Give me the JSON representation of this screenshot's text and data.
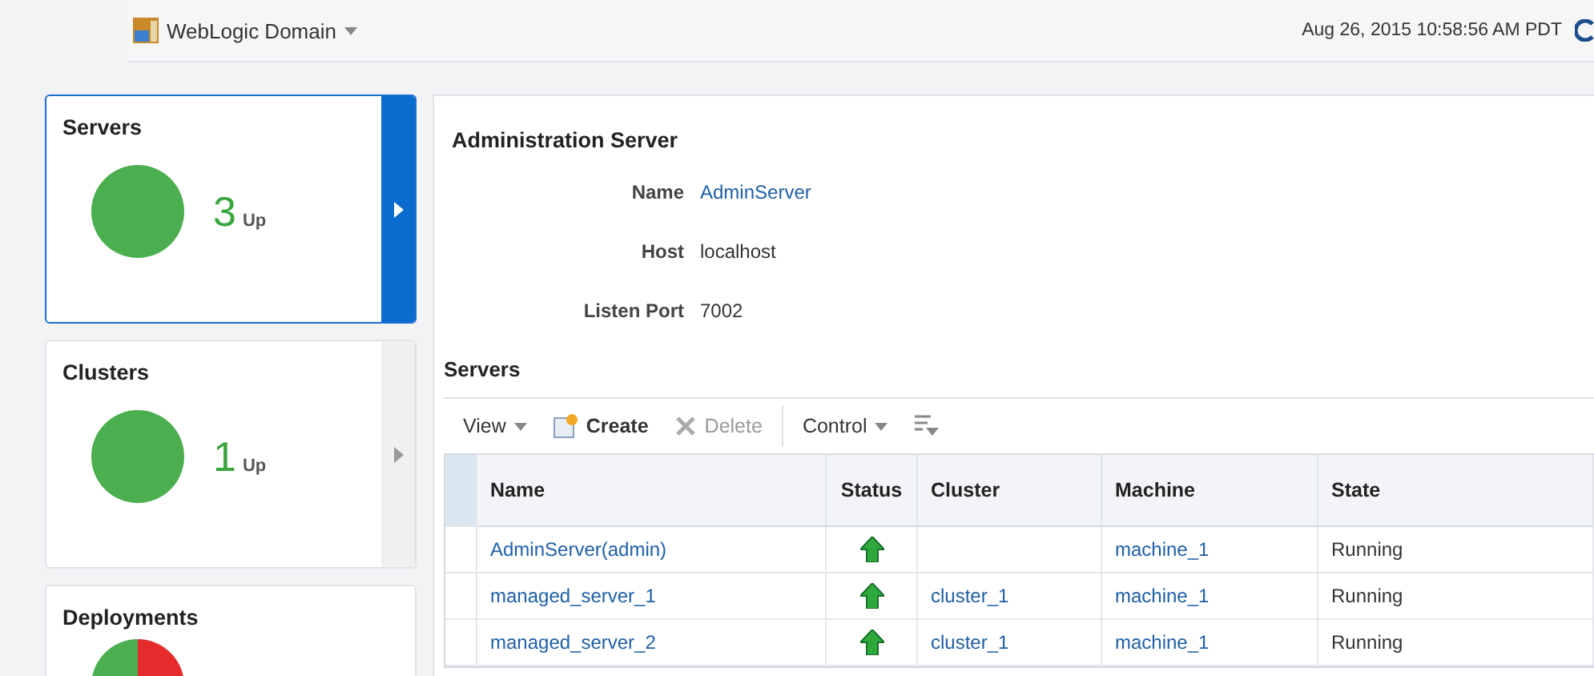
{
  "header": {
    "domain": "WebLogic Domain",
    "timestamp": "Aug 26, 2015 10:58:56 AM PDT"
  },
  "cards": [
    {
      "title": "Servers",
      "count": "3",
      "unit": "Up",
      "kind": "up",
      "selected": true
    },
    {
      "title": "Clusters",
      "count": "1",
      "unit": "Up",
      "kind": "up",
      "selected": false
    },
    {
      "title": "Deployments",
      "kind": "mixed",
      "selected": false
    }
  ],
  "admin": {
    "title": "Administration Server",
    "fields": [
      {
        "label": "Name",
        "value": "AdminServer",
        "link": true
      },
      {
        "label": "Host",
        "value": "localhost",
        "link": false
      },
      {
        "label": "Listen Port",
        "value": "7002",
        "link": false
      }
    ]
  },
  "servers": {
    "title": "Servers",
    "toolbar": [
      {
        "label": "View",
        "kind": "menu"
      },
      {
        "label": "Create",
        "kind": "create"
      },
      {
        "label": "Delete",
        "kind": "delete",
        "disabled": true
      },
      {
        "label": "Control",
        "kind": "menu"
      },
      {
        "kind": "filter"
      }
    ],
    "columns": [
      "Name",
      "Status",
      "Cluster",
      "Machine",
      "State"
    ],
    "rows": [
      {
        "name": "AdminServer(admin)",
        "up": true,
        "machine": "machine_1",
        "state": "Running"
      },
      {
        "name": "managed_server_1",
        "up": true,
        "cluster": "cluster_1",
        "machine": "machine_1",
        "state": "Running"
      },
      {
        "name": "managed_server_2",
        "up": true,
        "cluster": "cluster_1",
        "machine": "machine_1",
        "state": "Running"
      }
    ]
  }
}
